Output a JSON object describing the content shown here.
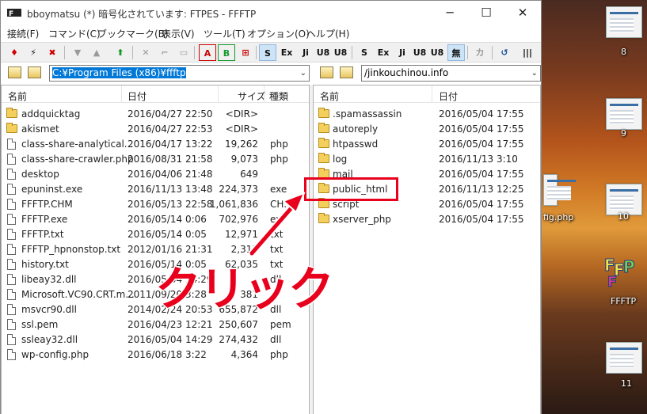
{
  "window": {
    "title": "bboymatsu (*) 暗号化されています: FTPES - FFFTP",
    "controls": {
      "minimize": "─",
      "maximize": "☐",
      "close": "✕"
    }
  },
  "menu": [
    "接続(F)",
    "コマンド(C)",
    "ブックマーク(B)",
    "表示(V)",
    "ツール(T)",
    "オプション(O)",
    "ヘルプ(H)"
  ],
  "toolbar": {
    "buttons": [
      "S",
      "Ex",
      "Ji",
      "U8",
      "U8",
      "S",
      "Ex",
      "Ji",
      "U8",
      "U8",
      "無",
      "カ"
    ]
  },
  "local": {
    "path": "C:¥Program Files (x86)¥ffftp",
    "headers": {
      "name": "名前",
      "date": "日付",
      "size": "サイズ",
      "type": "種類"
    },
    "rows": [
      {
        "name": "addquicktag",
        "date": "2016/04/27 22:50",
        "size": "<DIR>",
        "type": "",
        "kind": "folder"
      },
      {
        "name": "akismet",
        "date": "2016/04/27 22:53",
        "size": "<DIR>",
        "type": "",
        "kind": "folder"
      },
      {
        "name": "class-share-analytical...",
        "date": "2016/04/17 13:22",
        "size": "19,262",
        "type": "php",
        "kind": "file"
      },
      {
        "name": "class-share-crawler.php",
        "date": "2016/08/31 21:58",
        "size": "9,073",
        "type": "php",
        "kind": "file"
      },
      {
        "name": "desktop",
        "date": "2016/04/06 21:48",
        "size": "649",
        "type": "",
        "kind": "file"
      },
      {
        "name": "epuninst.exe",
        "date": "2016/11/13 13:48",
        "size": "224,373",
        "type": "exe",
        "kind": "file"
      },
      {
        "name": "FFFTP.CHM",
        "date": "2016/05/13 22:58",
        "size": "1,061,836",
        "type": "CH...",
        "kind": "file"
      },
      {
        "name": "FFFTP.exe",
        "date": "2016/05/14 0:06",
        "size": "702,976",
        "type": "ex",
        "kind": "file"
      },
      {
        "name": "FFFTP.txt",
        "date": "2016/05/14 0:05",
        "size": "12,971",
        "type": "txt",
        "kind": "file"
      },
      {
        "name": "FFFTP_hpnonstop.txt",
        "date": "2012/01/16 21:31",
        "size": "2,311",
        "type": "txt",
        "kind": "file"
      },
      {
        "name": "history.txt",
        "date": "2016/05/14 0:05",
        "size": "62,035",
        "type": "txt",
        "kind": "file"
      },
      {
        "name": "libeay32.dll",
        "date": "2016/05/04 14:29",
        "size": "",
        "type": "dll",
        "kind": "file"
      },
      {
        "name": "Microsoft.VC90.CRT.m...",
        "date": "2011/09/20 3:28",
        "size": "381",
        "type": "",
        "kind": "file"
      },
      {
        "name": "msvcr90.dll",
        "date": "2014/02/24 20:53",
        "size": "655,872",
        "type": "dll",
        "kind": "file"
      },
      {
        "name": "ssl.pem",
        "date": "2016/04/23 12:21",
        "size": "250,607",
        "type": "pem",
        "kind": "file"
      },
      {
        "name": "ssleay32.dll",
        "date": "2016/05/04 14:29",
        "size": "274,432",
        "type": "dll",
        "kind": "file"
      },
      {
        "name": "wp-config.php",
        "date": "2016/06/18 3:22",
        "size": "4,364",
        "type": "php",
        "kind": "file"
      }
    ]
  },
  "remote": {
    "path": "/jinkouchinou.info",
    "headers": {
      "name": "名前",
      "date": "日付"
    },
    "rows": [
      {
        "name": ".spamassassin",
        "date": "2016/05/04 17:55"
      },
      {
        "name": "autoreply",
        "date": "2016/05/04 17:55"
      },
      {
        "name": "htpasswd",
        "date": "2016/05/04 17:55"
      },
      {
        "name": "log",
        "date": "2016/11/13 3:10"
      },
      {
        "name": "mail",
        "date": "2016/05/04 17:55"
      },
      {
        "name": "public_html",
        "date": "2016/11/13 12:25"
      },
      {
        "name": "script",
        "date": "2016/05/04 17:55"
      },
      {
        "name": "xserver_php",
        "date": "2016/05/04 17:55"
      }
    ]
  },
  "annotation": {
    "label": "クリック",
    "color": "#e8001c"
  },
  "desktop": {
    "labels": [
      "8",
      "9",
      "fig.php",
      "10",
      "FFFTP",
      "11"
    ]
  }
}
